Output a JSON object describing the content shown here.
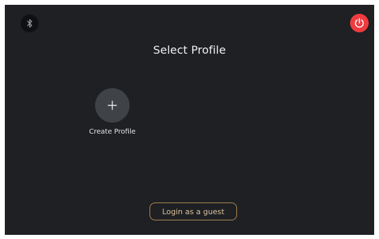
{
  "header": {
    "title": "Select Profile",
    "bluetooth_icon": "bluetooth-icon",
    "power_icon": "power-icon"
  },
  "profiles": {
    "create": {
      "label": "Create Profile",
      "icon": "plus-icon"
    }
  },
  "footer": {
    "guest_label": "Login as a guest"
  },
  "colors": {
    "background": "#1e2023",
    "power_accent": "#ef3b3f",
    "guest_border": "#b28a55",
    "avatar_bg": "#3f4247"
  }
}
